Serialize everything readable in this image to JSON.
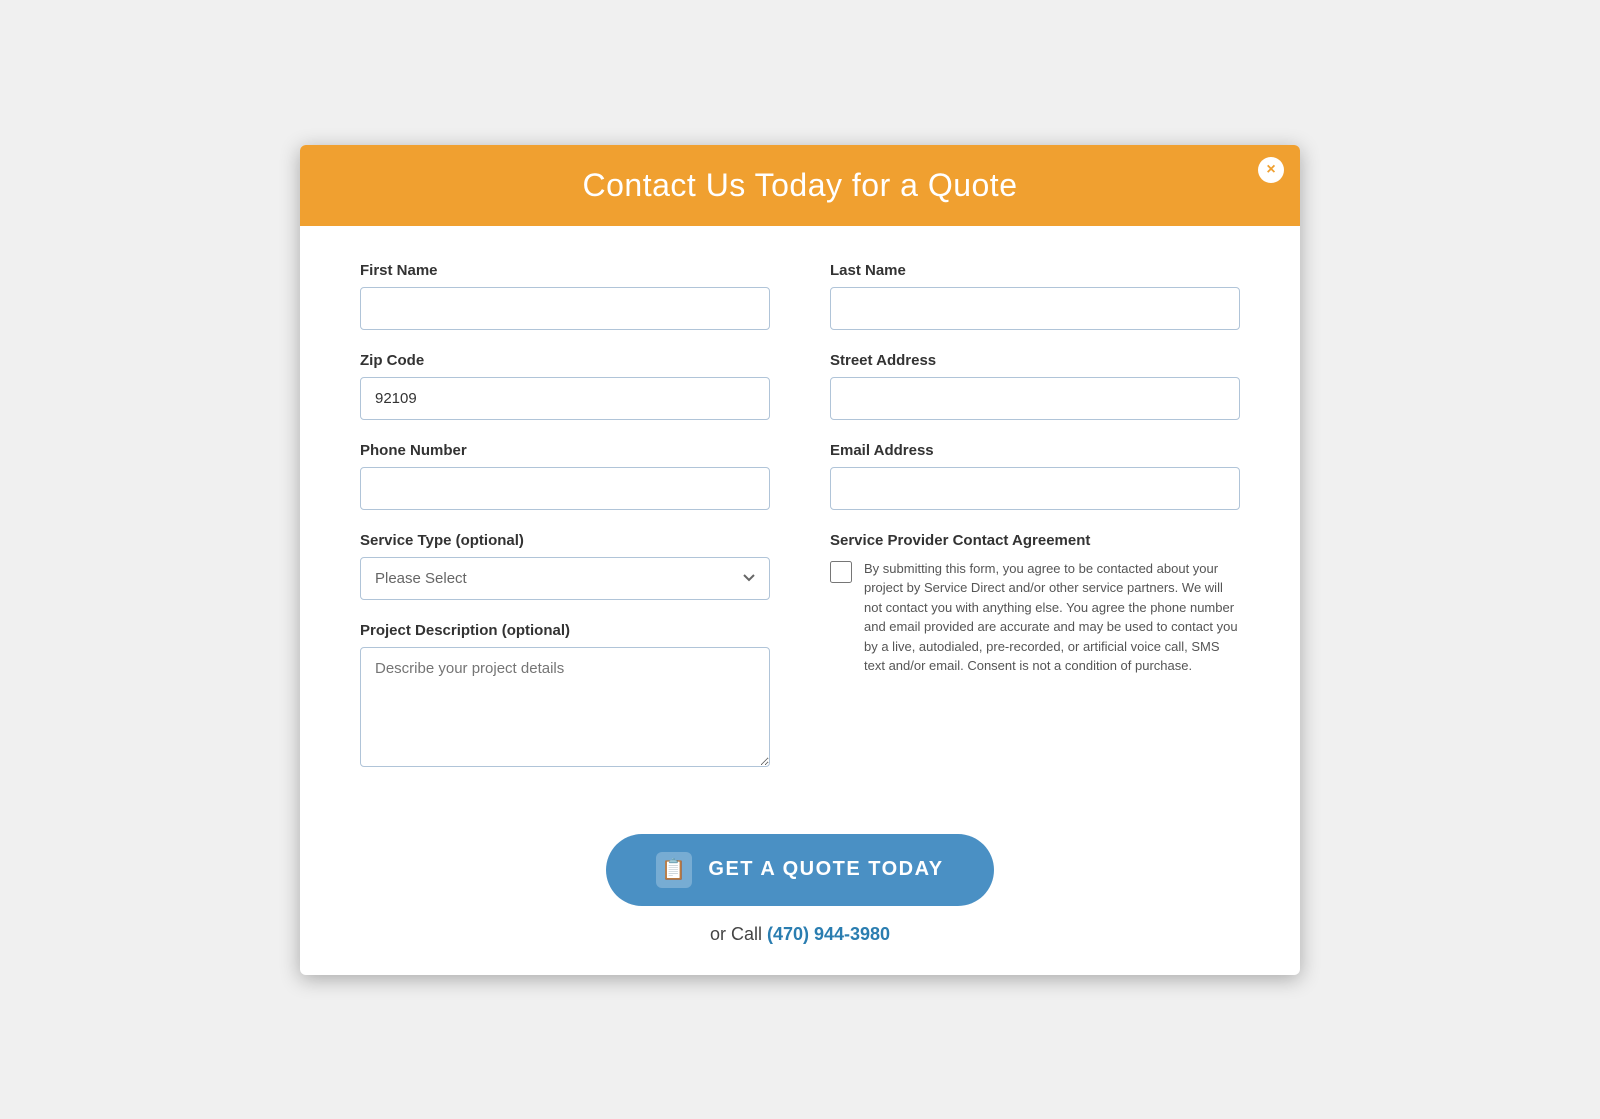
{
  "modal": {
    "title": "Contact Us Today for a Quote",
    "close_label": "×"
  },
  "form": {
    "first_name": {
      "label": "First Name",
      "value": "",
      "placeholder": ""
    },
    "last_name": {
      "label": "Last Name",
      "value": "",
      "placeholder": ""
    },
    "zip_code": {
      "label": "Zip Code",
      "value": "92109",
      "placeholder": ""
    },
    "street_address": {
      "label": "Street Address",
      "value": "",
      "placeholder": ""
    },
    "phone_number": {
      "label": "Phone Number",
      "value": "",
      "placeholder": ""
    },
    "email_address": {
      "label": "Email Address",
      "value": "",
      "placeholder": ""
    },
    "service_type": {
      "label": "Service Type (optional)",
      "placeholder": "Please Select"
    },
    "project_description": {
      "label": "Project Description (optional)",
      "placeholder": "Describe your project details"
    },
    "agreement": {
      "title": "Service Provider Contact Agreement",
      "text": "By submitting this form, you agree to be contacted about your project by Service Direct and/or other service partners. We will not contact you with anything else. You agree the phone number and email provided are accurate and may be used to contact you by a live, autodialed, pre-recorded, or artificial voice call, SMS text and/or email. Consent is not a condition of purchase."
    }
  },
  "footer": {
    "quote_button_label": "GET A QUOTE TODAY",
    "call_text": "or Call",
    "call_number": "(470) 944-3980",
    "call_href": "tel:4709443980"
  }
}
